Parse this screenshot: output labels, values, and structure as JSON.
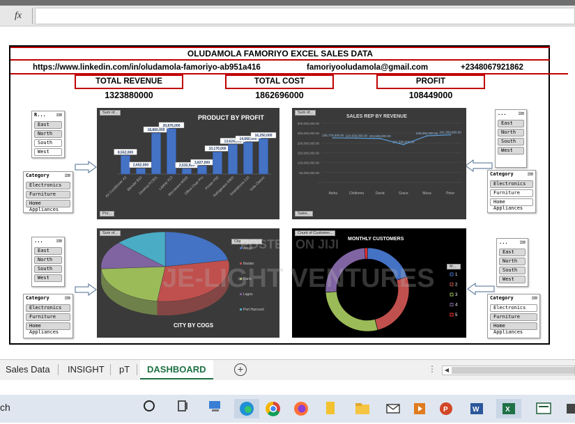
{
  "formula_bar": {
    "fx_label": "fx"
  },
  "dashboard": {
    "title": "OLUDAMOLA FAMORIYO EXCEL SALES DATA",
    "linkedin": "https://www.linkedin.com/in/oludamola-famoriyo-ab951a416",
    "email": "famoriyooludamola@gmail.com",
    "phone": "+2348067921862",
    "kpis": [
      {
        "label": "TOTAL REVENUE",
        "value": "1323880000"
      },
      {
        "label": "TOTAL COST",
        "value": "1862696000"
      },
      {
        "label": "PROFIT",
        "value": "108449000"
      }
    ]
  },
  "slicers": {
    "region_tl": {
      "title": "R...",
      "items": [
        "East",
        "North",
        "South",
        "West"
      ]
    },
    "category_tl": {
      "title": "Category",
      "items": [
        "Electronics",
        "Furniture",
        "Home Appliances"
      ]
    },
    "region_tr": {
      "title": "...",
      "items": [
        "East",
        "North",
        "South",
        "West"
      ]
    },
    "category_tr": {
      "title": "Category",
      "items": [
        "Electronics",
        "Furniture",
        "Home Appliances"
      ]
    },
    "region_bl": {
      "title": "...",
      "items": [
        "East",
        "North",
        "South",
        "West"
      ]
    },
    "category_bl": {
      "title": "Category",
      "items": [
        "Electronics",
        "Furniture",
        "Home Appliances"
      ]
    },
    "region_br": {
      "title": "...",
      "items": [
        "East",
        "North",
        "South",
        "West"
      ]
    },
    "category_br": {
      "title": "Category",
      "items": [
        "Electronics",
        "Furniture",
        "Home Appliances"
      ]
    }
  },
  "chart_data": [
    {
      "type": "bar",
      "title": "PRODUCT BY PROFIT",
      "field_chip": "Sum of...",
      "filter_chip": "Pro...",
      "categories": [
        "Air Conditioner X2",
        "Blender B10",
        "Desktop PC501",
        "Laptop X13",
        "Microwave M500",
        "Office Chair Pro",
        "Printer P50",
        "Refrigerator R800",
        "Smartphone Z10",
        "Sofa Classic"
      ],
      "values": [
        8552000,
        2652000,
        18860000,
        20876000,
        2532000,
        3827000,
        10170000,
        13624000,
        14660000,
        16250000
      ],
      "labels": [
        "8,552,000",
        "2,652,000",
        "18,860,000",
        "20,876,000",
        "2,532,000",
        "3,827,000",
        "10,170,000",
        "13,624,000",
        "14,660,000",
        "16,250,000"
      ],
      "ylim": [
        0,
        24000000
      ],
      "color": "#4472c4"
    },
    {
      "type": "line",
      "title": "SALES REP BY REVENUE",
      "field_chip": "Sum of...",
      "filter_chip": "Sales...",
      "categories": [
        "Aisha",
        "Chidinma",
        "David",
        "Grace",
        "Musa",
        "Peter"
      ],
      "y_ticks": [
        "300,000,000.00",
        "250,000,000.00",
        "200,000,000.00",
        "150,000,000.00",
        "100,000,000.00",
        "50,000,000.00",
        "-"
      ],
      "values": [
        225776000,
        224530000,
        222628000,
        191558000,
        236090000,
        241359000
      ],
      "labels": [
        "225,776,000.00",
        "224,530,000.00",
        "222,628,000.00",
        "191,558,000.00",
        "236,090,000.00",
        "241,359,000.00"
      ],
      "ylim": [
        0,
        300000000
      ],
      "color": "#5b9bd5"
    },
    {
      "type": "pie",
      "title": "CITY BY COGS",
      "field_chip": "Sum of...",
      "legend_chip": "City",
      "legend": [
        "Abuja",
        "Ibadan",
        "Kano",
        "Lagos",
        "Port Harcourt"
      ],
      "values": [
        0.22,
        0.3,
        0.22,
        0.13,
        0.13
      ],
      "colors": [
        "#4472c4",
        "#c0504d",
        "#9bbb59",
        "#8064a2",
        "#4bacc6"
      ]
    },
    {
      "type": "pie",
      "title": "MONTHLY CUSTOMERS",
      "field_chip": "Count of Customer...",
      "legend_chip": "M...",
      "legend": [
        "1",
        "2",
        "3",
        "4",
        "5"
      ],
      "values": [
        0.2,
        0.26,
        0.28,
        0.25,
        0.01
      ],
      "colors": [
        "#4472c4",
        "#c0504d",
        "#9bbb59",
        "#8064a2",
        "#ff3333"
      ]
    }
  ],
  "watermarks": {
    "top": "POSTED ON JIJI",
    "main": "JE-LIGHT VENTURES"
  },
  "tabs": [
    {
      "label": "Sales Data"
    },
    {
      "label": "INSIGHT"
    },
    {
      "label": "pT"
    },
    {
      "label": "DASHBOARD",
      "active": true
    }
  ],
  "add_sheet_label": "+",
  "taskbar": {
    "search_stub": "ch",
    "apps": [
      "start-circle",
      "task-view",
      "explorer-pc",
      "edge",
      "chrome",
      "firefox",
      "sticky-file",
      "file-explorer",
      "mail",
      "media-player",
      "powerpoint",
      "word",
      "excel",
      "other-app"
    ]
  }
}
